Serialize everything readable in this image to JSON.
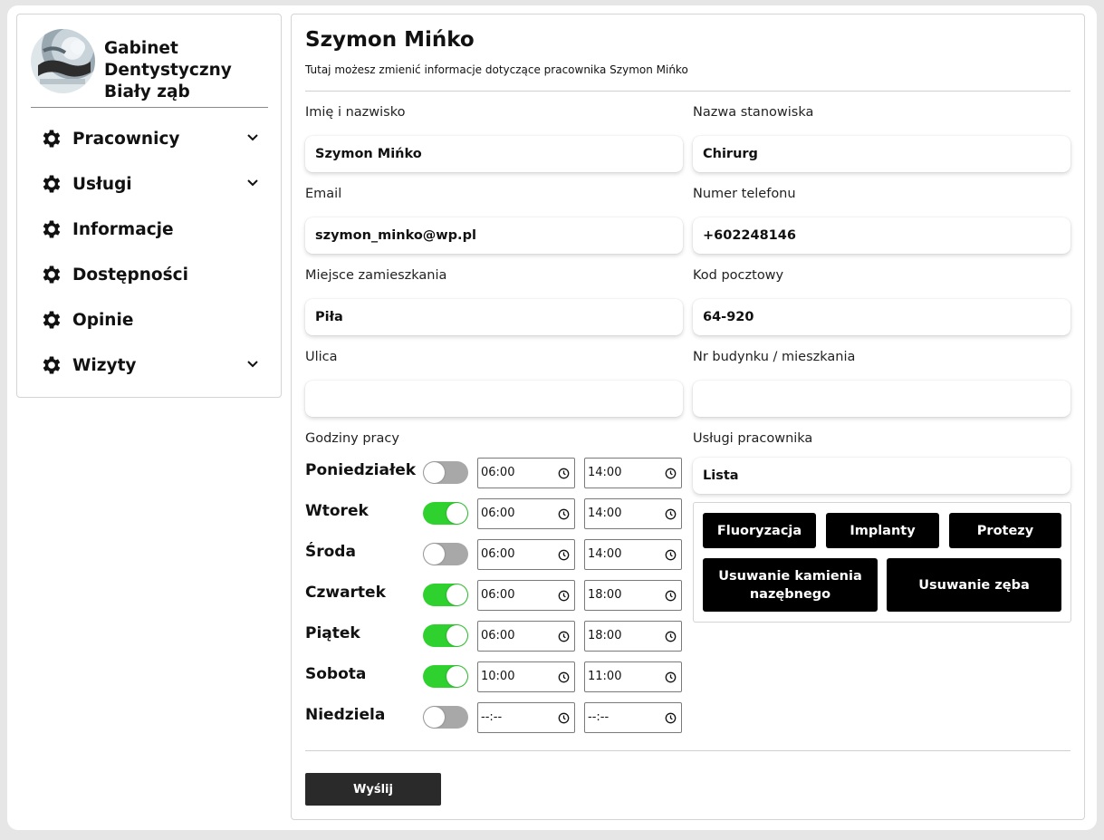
{
  "sidebar": {
    "brand_lines": [
      "Gabinet",
      "Dentystyczny",
      "Biały ząb"
    ],
    "items": [
      {
        "label": "Pracownicy",
        "icon": "gear-icon",
        "expandable": true
      },
      {
        "label": "Usługi",
        "icon": "gear-icon",
        "expandable": true
      },
      {
        "label": "Informacje",
        "icon": "gear-icon",
        "expandable": false
      },
      {
        "label": "Dostępności",
        "icon": "gear-icon",
        "expandable": false
      },
      {
        "label": "Opinie",
        "icon": "gear-icon",
        "expandable": false
      },
      {
        "label": "Wizyty",
        "icon": "gear-icon",
        "expandable": true
      }
    ]
  },
  "header": {
    "title": "Szymon Mińko",
    "subtitle": "Tutaj możesz zmienić informacje dotyczące pracownika Szymon Mińko"
  },
  "form": {
    "name": {
      "label": "Imię i nazwisko",
      "value": "Szymon Mińko"
    },
    "position": {
      "label": "Nazwa stanowiska",
      "value": "Chirurg"
    },
    "email": {
      "label": "Email",
      "value": "szymon_minko@wp.pl"
    },
    "phone": {
      "label": "Numer telefonu",
      "value": "+602248146"
    },
    "city": {
      "label": "Miejsce zamieszkania",
      "value": "Piła"
    },
    "postal": {
      "label": "Kod pocztowy",
      "value": "64-920"
    },
    "street": {
      "label": "Ulica",
      "value": ""
    },
    "building": {
      "label": "Nr budynku / mieszkania",
      "value": ""
    }
  },
  "hours": {
    "label": "Godziny pracy",
    "days": [
      {
        "name": "Poniedziałek",
        "enabled": false,
        "start": "06:00",
        "end": "14:00"
      },
      {
        "name": "Wtorek",
        "enabled": true,
        "start": "06:00",
        "end": "14:00"
      },
      {
        "name": "Środa",
        "enabled": false,
        "start": "06:00",
        "end": "14:00"
      },
      {
        "name": "Czwartek",
        "enabled": true,
        "start": "06:00",
        "end": "18:00"
      },
      {
        "name": "Piątek",
        "enabled": true,
        "start": "06:00",
        "end": "18:00"
      },
      {
        "name": "Sobota",
        "enabled": true,
        "start": "10:00",
        "end": "11:00"
      },
      {
        "name": "Niedziela",
        "enabled": false,
        "start": "--:--",
        "end": "--:--"
      }
    ]
  },
  "services": {
    "label": "Usługi pracownika",
    "select_value": "Lista",
    "buttons": [
      "Fluoryzacja",
      "Implanty",
      "Protezy",
      "Usuwanie kamienia nazębnego",
      "Usuwanie zęba"
    ]
  },
  "submit_label": "Wyślij",
  "colors": {
    "toggle_on": "#2fd12f",
    "toggle_off": "#a8a8a8",
    "button_bg": "#000000"
  }
}
